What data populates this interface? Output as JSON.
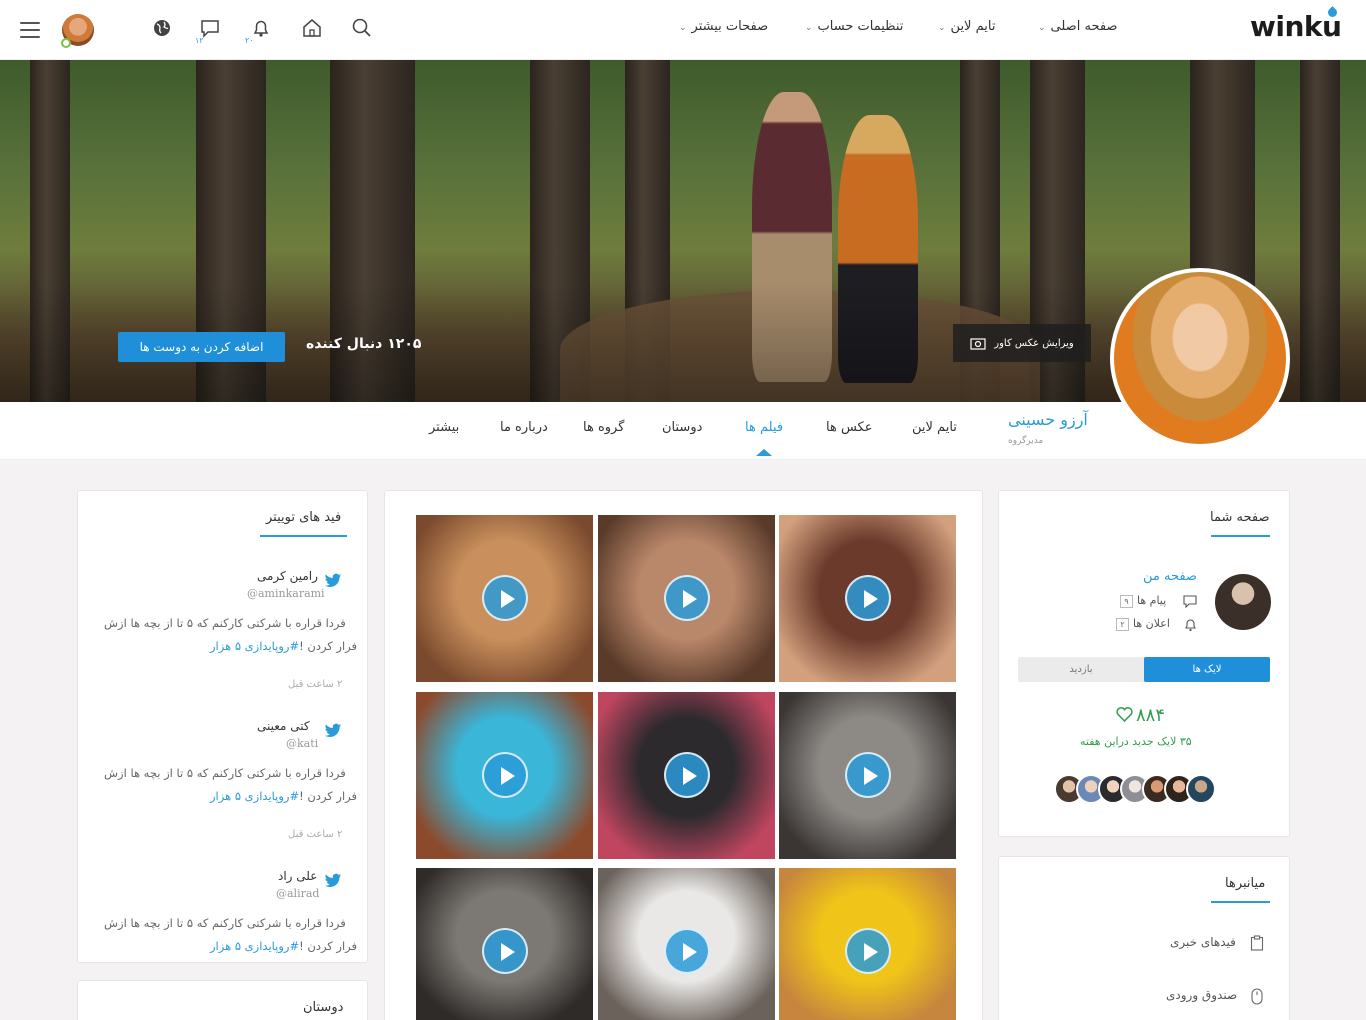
{
  "brand": {
    "logo": "winku",
    "accent": "#2a9bd8"
  },
  "topbar": {
    "nav": [
      {
        "label": "صفحه اصلی"
      },
      {
        "label": "تایم لاین"
      },
      {
        "label": "تنظیمات حساب"
      },
      {
        "label": "صفحات بیشتر"
      }
    ],
    "icons": [
      "search-icon",
      "home-icon",
      "bell-icon",
      "chat-icon",
      "globe-icon"
    ],
    "bell_count": "۲۰",
    "chat_count": "۱۲"
  },
  "cover": {
    "edit_label": "ویرایش عکس کاور",
    "followers": "۱۲۰۵ دنبال کننده",
    "add_friend": "اضافه کردن به دوست ها"
  },
  "profile": {
    "name": "آرزو حسینی",
    "role": "مدیرگروه",
    "tabs": [
      {
        "label": "تایم لاین"
      },
      {
        "label": "عکس ها"
      },
      {
        "label": "فیلم ها"
      },
      {
        "label": "دوستان"
      },
      {
        "label": "گروه ها"
      },
      {
        "label": "درباره ما"
      },
      {
        "label": "بیشتر"
      }
    ],
    "active_tab": "فیلم ها"
  },
  "twitter": {
    "title": "فید های توییتر",
    "tweets": [
      {
        "name": "رامین کرمی",
        "handle": "@aminkarami",
        "line1": "فردا قراره با شرکتی کارکنم که ۵ تا از بچه ها ازش",
        "line2_text": "فرار کردن !",
        "line2_tag": "#روپایدازی ۵ هزار",
        "time": "۲ ساعت قبل"
      },
      {
        "name": "کتی معینی",
        "handle": "@kati",
        "line1": "فردا قراره با شرکتی کارکنم که ۵ تا از بچه ها ازش",
        "line2_text": "فرار کردن !",
        "line2_tag": "#روپایدازی ۵ هزار",
        "time": "۲ ساعت قبل"
      },
      {
        "name": "علی راد",
        "handle": "@alirad",
        "line1": "فردا قراره با شرکتی کارکنم که ۵ تا از بچه ها ازش",
        "line2_text": "فرار کردن !",
        "line2_tag": "#روپایدازی ۵ هزار"
      }
    ]
  },
  "friends": {
    "title": "دوستان"
  },
  "your_page": {
    "title": "صفحه شما",
    "my_page": "صفحه من",
    "messages_label": "پیام ها",
    "messages_count": "۹",
    "notices_label": "اعلان ها",
    "notices_count": "۲",
    "tab_likes": "لایک ها",
    "tab_visits": "بازدید",
    "likes_total": "۸۸۴",
    "likes_new": "۳۵ لایک جدید دراین هفته"
  },
  "shortcuts": {
    "title": "میانبرها",
    "items": [
      {
        "label": "فیدهای خبری",
        "icon": "clipboard-icon"
      },
      {
        "label": "صندوق ورودی",
        "icon": "mouse-icon"
      }
    ]
  },
  "videos": {
    "count": 9,
    "palette": [
      [
        "#c98f5c",
        "#7a4a2e"
      ],
      [
        "#b9876a",
        "#5a3b2a"
      ],
      [
        "#6b3a2b",
        "#d2a07d"
      ],
      [
        "#3ab6d8",
        "#8c4a2d"
      ],
      [
        "#2d2a2e",
        "#c04660"
      ],
      [
        "#8d8a86",
        "#3b3634"
      ],
      [
        "#7c7873",
        "#2f2b29"
      ],
      [
        "#e9e8e6",
        "#6c625c"
      ],
      [
        "#f0c418",
        "#c6863e"
      ]
    ]
  }
}
